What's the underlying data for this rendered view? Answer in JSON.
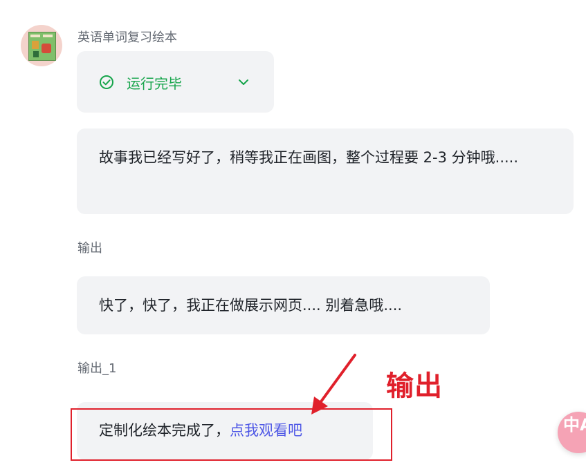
{
  "sender": {
    "name": "英语单词复习绘本"
  },
  "status": {
    "text": "运行完毕",
    "icon": "check-circle-icon",
    "color": "#15a44a"
  },
  "messages": {
    "first": "故事我已经写好了，稍等我正在画图，整个过程要 2-3 分钟哦.....",
    "output_label": "输出",
    "second": "快了，快了，我正在做展示网页.... 别着急哦....",
    "output1_label": "输出_1",
    "third_prefix": "定制化绘本完成了，",
    "third_link": "点我观看吧"
  },
  "annotation": {
    "text": "输出",
    "color": "#e0202b"
  },
  "translate_button": {
    "glyph": "中A"
  }
}
